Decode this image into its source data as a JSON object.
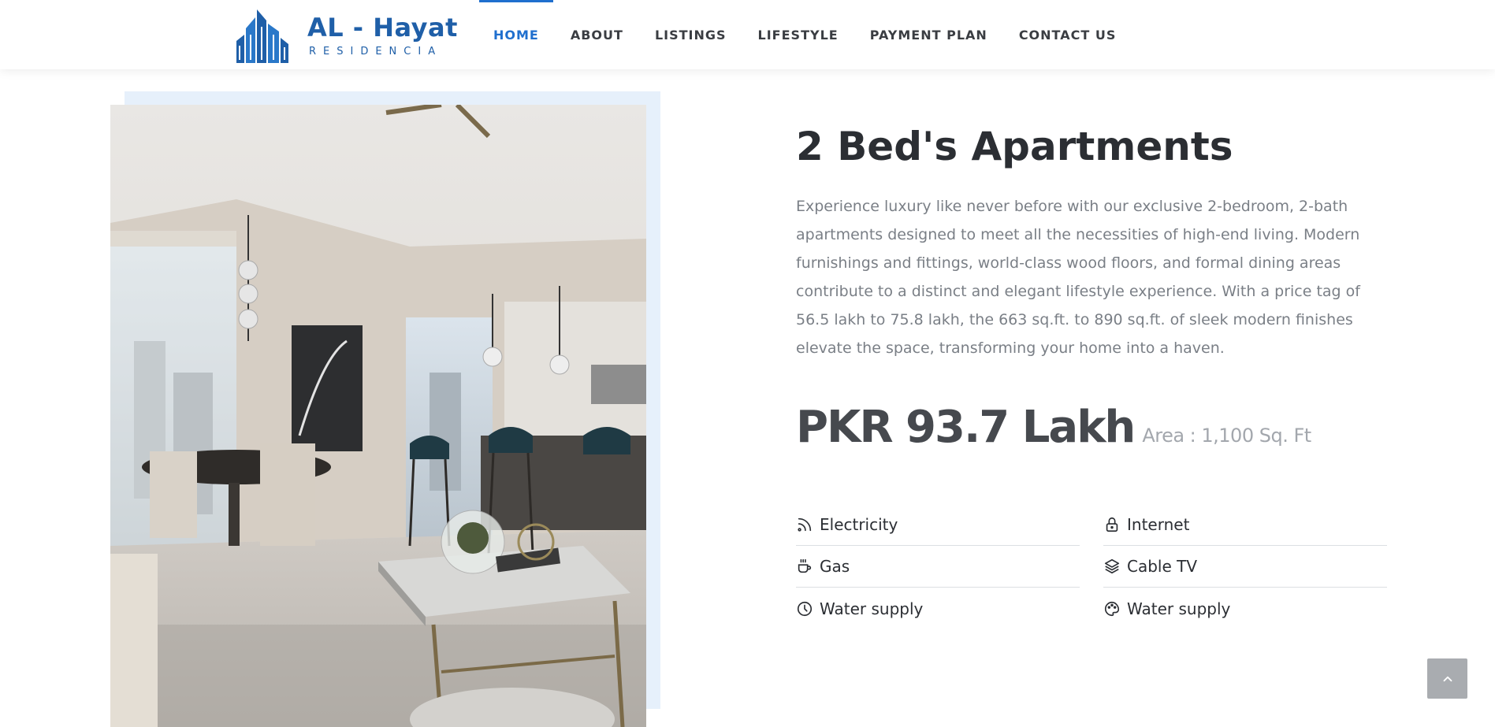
{
  "brand": {
    "title": "AL - Hayat",
    "subtitle": "RESIDENCIA",
    "color": "#1f5fa8"
  },
  "nav": {
    "active_color": "#1f6fce",
    "items": [
      {
        "label": "HOME",
        "active": true
      },
      {
        "label": "ABOUT",
        "active": false
      },
      {
        "label": "LISTINGS",
        "active": false
      },
      {
        "label": "LIFESTYLE",
        "active": false
      },
      {
        "label": "PAYMENT PLAN",
        "active": false
      },
      {
        "label": "CONTACT US",
        "active": false
      }
    ]
  },
  "listing": {
    "title": "2 Bed's Apartments",
    "description": "Experience luxury like never before with our exclusive 2-bedroom, 2-bath apartments designed to meet all the necessities of high-end living. Modern furnishings and fittings, world-class wood floors, and formal dining areas contribute to a distinct and elegant lifestyle experience. With a price tag of 56.5 lakh to 75.8 lakh, the 663 sq.ft. to 890 sq.ft. of sleek modern finishes elevate the space, transforming your home into a haven.",
    "price": "PKR 93.7 Lakh",
    "area": "Area : 1,100 Sq. Ft",
    "image_alt": "interior-photo-dining-kitchen"
  },
  "amenities": [
    {
      "label": "Electricity",
      "icon": "rss-icon"
    },
    {
      "label": "Internet",
      "icon": "lock-icon"
    },
    {
      "label": "Gas",
      "icon": "cup-icon"
    },
    {
      "label": "Cable TV",
      "icon": "layers-icon"
    },
    {
      "label": "Water supply",
      "icon": "clock-icon"
    },
    {
      "label": "Water supply",
      "icon": "palette-icon"
    }
  ],
  "back_to_top": {
    "icon": "chevron-up-icon"
  }
}
